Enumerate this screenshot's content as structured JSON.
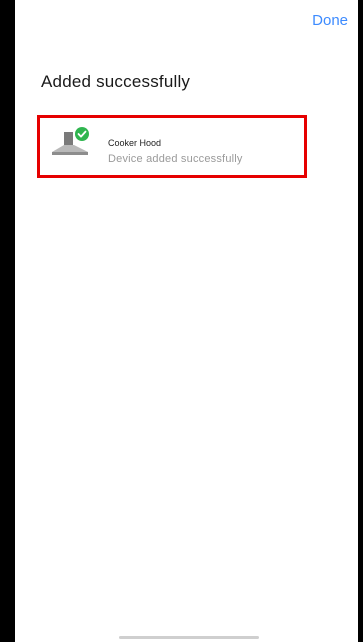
{
  "header": {
    "done_label": "Done"
  },
  "page": {
    "title": "Added successfully"
  },
  "devices": [
    {
      "name": "Cooker Hood",
      "status": "Device added successfully",
      "icon": "cooker-hood-icon",
      "badge_icon": "check-badge-icon"
    }
  ],
  "colors": {
    "accent": "#3d8bff",
    "highlight_border": "#e60000",
    "success_badge": "#2fb54f",
    "status_text": "#9a9a9a"
  }
}
